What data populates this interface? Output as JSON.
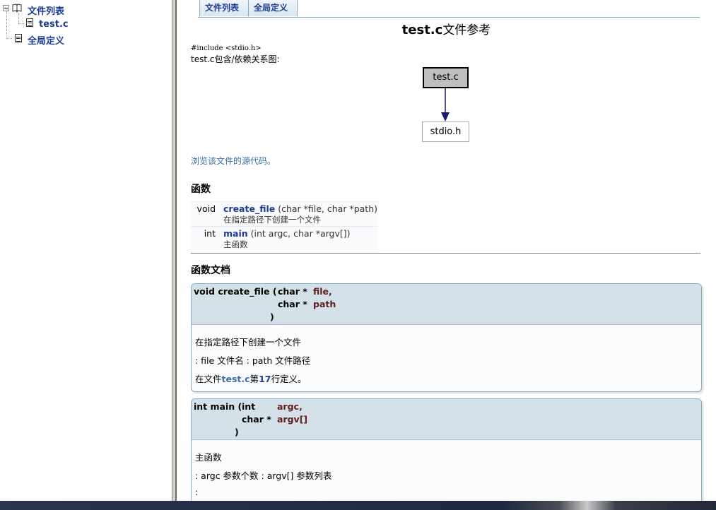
{
  "tree": {
    "root_label": "文件列表",
    "file_label": "test.c",
    "globals_label": "全局定义"
  },
  "tabs": [
    {
      "label": "文件列表"
    },
    {
      "label": "全局定义"
    }
  ],
  "page": {
    "title_file": "test.c",
    "title_suffix": "文件参考",
    "include_line": "#include <stdio.h>",
    "deps_label": "test.c包含/依赖关系图:",
    "graph": {
      "node_main": "test.c",
      "node_dep": "stdio.h",
      "node_main_color": "#bfbfbf",
      "edge_color": "#191970"
    },
    "source_link": "浏览该文件的源代码。",
    "functions_heading": "函数",
    "functions": [
      {
        "type": "void",
        "name": "create_file",
        "args": "(char *file, char *path)",
        "desc": "在指定路径下创建一个文件"
      },
      {
        "type": "int",
        "name": "main",
        "args": "(int argc, char *argv[])",
        "desc": "主函数"
      }
    ],
    "docs_heading": "函数文档",
    "docs": [
      {
        "proto_prefix": "void create_file (",
        "params": [
          {
            "type": "char *",
            "name": "file,"
          },
          {
            "type": "char *",
            "name": "path"
          }
        ],
        "close": ")",
        "brief": "在指定路径下创建一个文件",
        "params_text": ": file 文件名 : path 文件路径",
        "def_prefix": "在文件",
        "def_file": "test.c",
        "def_mid": "第",
        "def_line": "17",
        "def_suffix": "行定义。"
      },
      {
        "proto_prefix": "int main (",
        "params": [
          {
            "type": "int",
            "name": "argc,"
          },
          {
            "type": "char *",
            "name": "argv[]"
          }
        ],
        "close": ")",
        "brief": "主函数",
        "params_text": ": argc 参数个数 : argv[] 参数列表",
        "return_text": ":"
      }
    ]
  },
  "colors": {
    "link": "#1e3c91",
    "param_name": "#602020",
    "header_bg": "#d5e1e8",
    "border": "#84b0c7"
  }
}
